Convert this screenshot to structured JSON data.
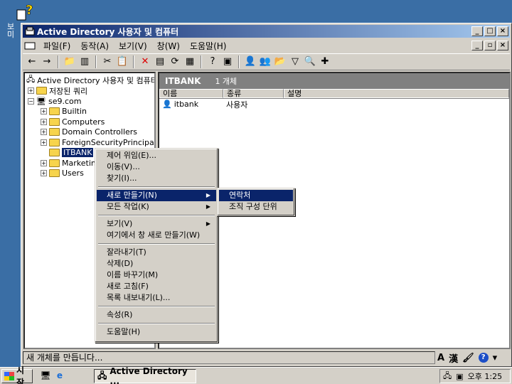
{
  "desktop": {
    "icon_label": "보\n미"
  },
  "window": {
    "title": "Active Directory 사용자 및 컴퓨터",
    "menu": [
      "파일(F)",
      "동작(A)",
      "보기(V)",
      "창(W)",
      "도움말(H)"
    ]
  },
  "tree": {
    "root": "Active Directory 사용자 및 컴퓨터",
    "saved_queries": "저장된 쿼리",
    "domain": "se9.com",
    "items": [
      "Builtin",
      "Computers",
      "Domain Controllers",
      "ForeignSecurityPrincipals",
      "ITBANK",
      "Marketin",
      "Users"
    ]
  },
  "details": {
    "header": "ITBANK",
    "count": "1 개체",
    "columns": [
      "이름",
      "종류",
      "설명"
    ],
    "rows": [
      {
        "name": "itbank",
        "type": "사용자",
        "desc": ""
      }
    ]
  },
  "context_menu": {
    "items": [
      "제어 위임(E)...",
      "이동(V)...",
      "찾기(I)...",
      "새로 만들기(N)",
      "모든 작업(K)",
      "보기(V)",
      "여기에서 창 새로 만들기(W)",
      "잘라내기(T)",
      "삭제(D)",
      "이름 바꾸기(M)",
      "새로 고침(F)",
      "목록 내보내기(L)...",
      "속성(R)",
      "도움말(H)"
    ]
  },
  "submenu": {
    "items": [
      "연락처",
      "조직 구성 단위"
    ]
  },
  "status": {
    "text": "새 개체를 만듭니다...",
    "ime_a": "A",
    "ime_han": "漢"
  },
  "taskbar": {
    "start": "시작",
    "task": "Active Directory ...",
    "clock": "오후 1:25"
  }
}
